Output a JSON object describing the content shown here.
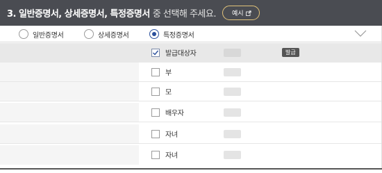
{
  "header": {
    "title": "3. 일반증명서, 상세증명서, 특정증명서",
    "title_suffix": "중 선택해 주세요.",
    "example_button_label": "예시"
  },
  "options": [
    {
      "label": "일반증명서",
      "selected": false
    },
    {
      "label": "상세증명서",
      "selected": false
    },
    {
      "label": "특정증명서",
      "selected": true
    }
  ],
  "rows": [
    {
      "label": "발급대상자",
      "checked": true,
      "badge": "발급"
    },
    {
      "label": "부",
      "checked": false
    },
    {
      "label": "모",
      "checked": false
    },
    {
      "label": "배우자",
      "checked": false
    },
    {
      "label": "자녀",
      "checked": false
    },
    {
      "label": "자녀",
      "checked": false
    }
  ],
  "colors": {
    "header_bg": "#4a4c52",
    "accent_gold": "#e2c37a",
    "radio_selected": "#2a4f9c",
    "badge_bg": "#555555"
  },
  "icons": {
    "example_button": "external-link-icon",
    "options_toggle": "chevron-down-icon",
    "row_check": "checkmark-icon"
  }
}
